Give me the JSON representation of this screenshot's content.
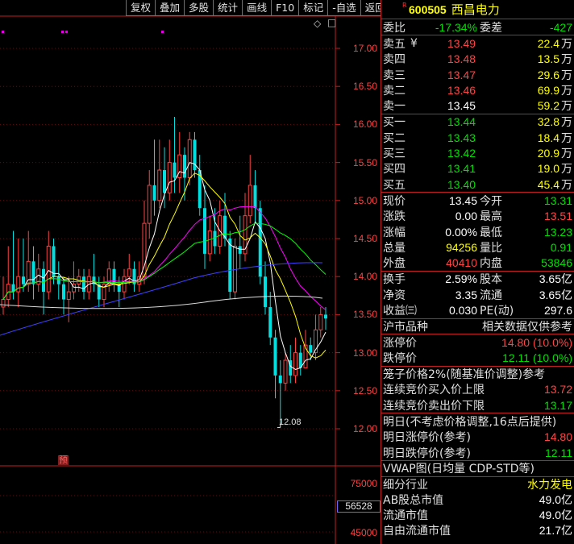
{
  "toolbar": [
    "复权",
    "叠加",
    "多股",
    "统计",
    "画线",
    "F10",
    "标记",
    "-自选",
    "返回"
  ],
  "chart": {
    "price_ticks": [
      "17.00",
      "16.50",
      "16.00",
      "15.50",
      "15.00",
      "14.50",
      "14.00",
      "13.50",
      "13.00",
      "12.50",
      "12.00"
    ],
    "volume_ticks": [
      "75000",
      "45000"
    ],
    "current_volume": "56528",
    "low_marker": "12.08",
    "settings_glyph": "◇",
    "collapse_glyph": "□",
    "event_marker": "预"
  },
  "chart_data": {
    "type": "candlestick",
    "price_range": [
      11.9,
      17.25
    ],
    "low_annotation": 12.08,
    "last_close": 13.45
  },
  "stock": {
    "badge": "R",
    "code": "600505",
    "name": "西昌电力"
  },
  "committee": {
    "ratio_label": "委比",
    "ratio": "-17.34%",
    "diff_label": "委差",
    "diff": "-427"
  },
  "asks": [
    {
      "label": "卖五",
      "mark": "¥",
      "price": "13.49",
      "vol": "22.4",
      "unit": "万"
    },
    {
      "label": "卖四",
      "mark": "",
      "price": "13.48",
      "vol": "13.5",
      "unit": "万"
    },
    {
      "label": "卖三",
      "mark": "",
      "price": "13.47",
      "vol": "29.6",
      "unit": "万"
    },
    {
      "label": "卖二",
      "mark": "",
      "price": "13.46",
      "vol": "69.9",
      "unit": "万"
    },
    {
      "label": "卖一",
      "mark": "",
      "price": "13.45",
      "vol": "59.2",
      "unit": "万"
    }
  ],
  "bids": [
    {
      "label": "买一",
      "price": "13.44",
      "vol": "32.8",
      "unit": "万"
    },
    {
      "label": "买二",
      "price": "13.43",
      "vol": "18.4",
      "unit": "万"
    },
    {
      "label": "买三",
      "price": "13.42",
      "vol": "20.9",
      "unit": "万"
    },
    {
      "label": "买四",
      "price": "13.41",
      "vol": "19.0",
      "unit": "万"
    },
    {
      "label": "买五",
      "price": "13.40",
      "vol": "45.4",
      "unit": "万"
    }
  ],
  "quote": [
    {
      "l1": "现价",
      "v1": "13.45",
      "c1": "white",
      "l2": "今开",
      "v2": "13.31",
      "c2": "green"
    },
    {
      "l1": "涨跌",
      "v1": "0.00",
      "c1": "white",
      "l2": "最高",
      "v2": "13.51",
      "c2": "red"
    },
    {
      "l1": "涨幅",
      "v1": "0.00%",
      "c1": "white",
      "l2": "最低",
      "v2": "13.23",
      "c2": "green"
    },
    {
      "l1": "总量",
      "v1": "94256",
      "c1": "yellow",
      "l2": "量比",
      "v2": "0.91",
      "c2": "green"
    },
    {
      "l1": "外盘",
      "v1": "40410",
      "c1": "red",
      "l2": "内盘",
      "v2": "53846",
      "c2": "green"
    }
  ],
  "fundamentals": [
    {
      "l1": "换手",
      "v1": "2.59%",
      "l2": "股本",
      "v2": "3.65亿"
    },
    {
      "l1": "净资",
      "v1": "3.35",
      "l2": "流通",
      "v2": "3.65亿"
    },
    {
      "l1": "收益㈢",
      "v1": "0.030",
      "l2": "PE(动)",
      "v2": "297.6"
    }
  ],
  "market": {
    "label": "沪市品种",
    "note": "相关数据仅供参考"
  },
  "limits": [
    {
      "label": "涨停价",
      "value": "14.80 (10.0%)",
      "color": "red"
    },
    {
      "label": "跌停价",
      "value": "12.11 (10.0%)",
      "color": "green"
    }
  ],
  "cage": {
    "title": "笼子价格2%(随基准价调整)参考",
    "buy_label": "连续竞价买入价上限",
    "buy_value": "13.72",
    "sell_label": "连续竞价卖出价下限",
    "sell_value": "13.17"
  },
  "tomorrow": {
    "note": "明日(不考虑价格调整,16点后提供)",
    "up_label": "明日涨停价(参考)",
    "up_value": "14.80",
    "down_label": "明日跌停价(参考)",
    "down_value": "12.11"
  },
  "vwap": {
    "title": "VWAP图(日均量 CDP-STD等)"
  },
  "industry": {
    "label": "细分行业",
    "value": "水力发电"
  },
  "caps": [
    {
      "label": "AB股总市值",
      "value": "49.0亿"
    },
    {
      "label": "流通市值",
      "value": "49.0亿"
    },
    {
      "label": "自由流通市值",
      "value": "21.7亿"
    }
  ]
}
